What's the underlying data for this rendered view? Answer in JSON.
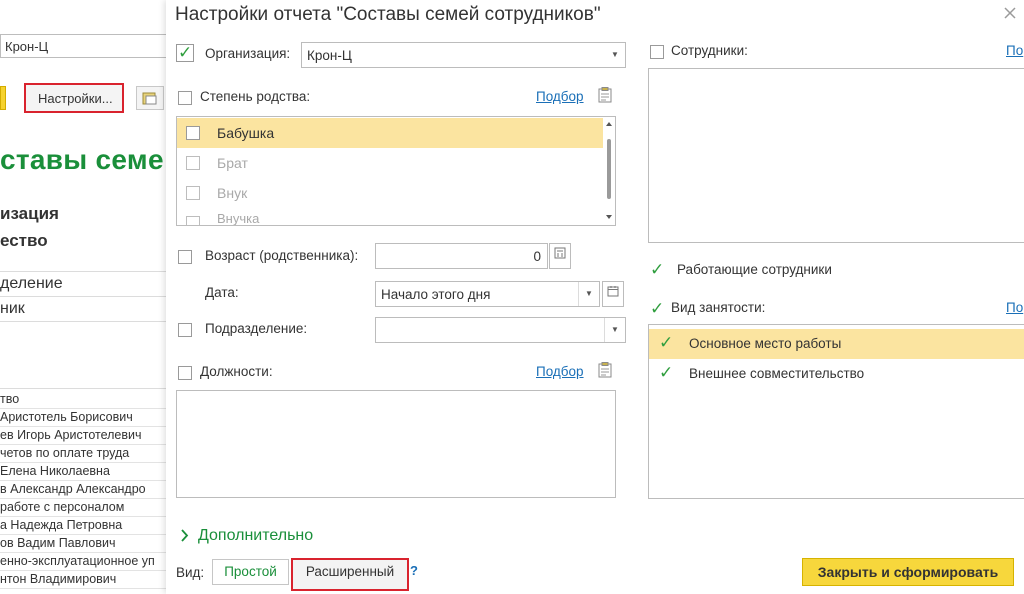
{
  "background": {
    "organization_value": "Крон-Ц",
    "settings_button": "Настройки...",
    "report_title": "ставы семе",
    "header_lines": [
      "изация",
      "ество"
    ],
    "group_lines": [
      "деление",
      "ник"
    ],
    "rows": [
      "тво",
      "Аристотель Борисович",
      "ев Игорь Аристотелевич",
      "четов по оплате труда",
      "Елена Николаевна",
      "в Александр Александро",
      "работе с персоналом",
      "а Надежда Петровна",
      "ов Вадим Павлович",
      "енно-эксплуатационное уп",
      "нтон Владимирович"
    ]
  },
  "dialog": {
    "title": "Настройки отчета \"Составы семей сотрудников\"",
    "organization": {
      "label": "Организация:",
      "value": "Крон-Ц",
      "checked": true
    },
    "relationship": {
      "label": "Степень родства:",
      "pick_link": "Подбор",
      "items": [
        "Бабушка",
        "Брат",
        "Внук",
        "Внучка"
      ]
    },
    "age": {
      "label": "Возраст (родственника):",
      "value": "0"
    },
    "date": {
      "label": "Дата:",
      "value": "Начало этого дня"
    },
    "department": {
      "label": "Подразделение:",
      "value": ""
    },
    "positions": {
      "label": "Должности:",
      "pick_link": "Подбор"
    },
    "employees": {
      "label": "Сотрудники:",
      "pick_link": "По"
    },
    "working_employees": {
      "label": "Работающие сотрудники",
      "checked": true
    },
    "employment": {
      "label": "Вид занятости:",
      "pick_link": "По",
      "checked": true,
      "items": [
        "Основное место работы",
        "Внешнее совместительство"
      ]
    },
    "additional": {
      "label": "Дополнительно"
    },
    "view": {
      "label": "Вид:",
      "simple": "Простой",
      "extended": "Расширенный",
      "help": "?"
    },
    "submit_button": "Закрыть и сформировать",
    "colors": {
      "accent_green": "#2f9e3e",
      "highlight": "#fbe4a0",
      "button_yellow": "#f7d73c",
      "link": "#1a6fb7",
      "callout_red": "#d9232e"
    }
  }
}
